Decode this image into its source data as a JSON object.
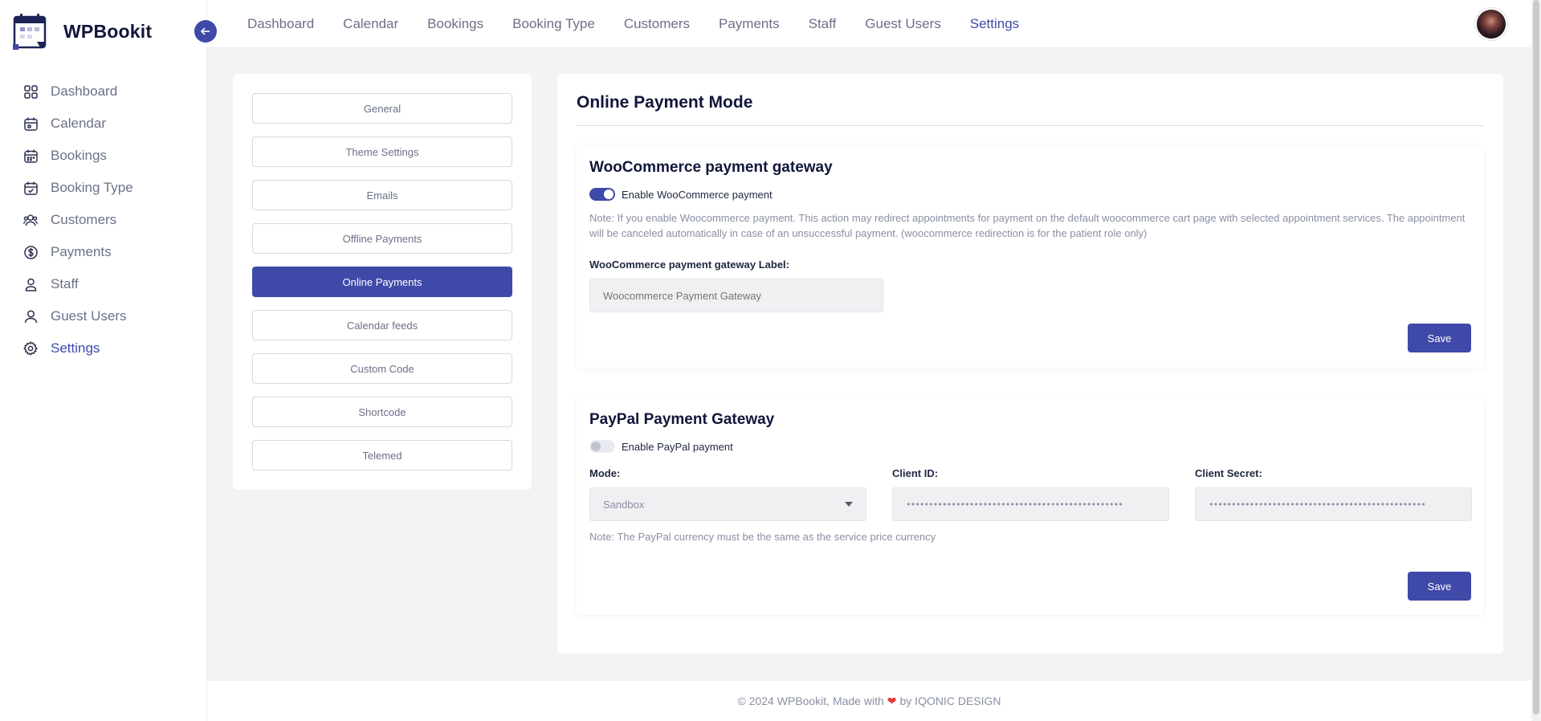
{
  "brand": {
    "name": "WPBookit"
  },
  "sidebar": {
    "items": [
      {
        "label": "Dashboard",
        "icon": "grid-icon"
      },
      {
        "label": "Calendar",
        "icon": "calendar-icon"
      },
      {
        "label": "Bookings",
        "icon": "calendar-grid-icon"
      },
      {
        "label": "Booking Type",
        "icon": "calendar-check-icon"
      },
      {
        "label": "Customers",
        "icon": "users-icon"
      },
      {
        "label": "Payments",
        "icon": "dollar-circle-icon"
      },
      {
        "label": "Staff",
        "icon": "user-icon"
      },
      {
        "label": "Guest Users",
        "icon": "user-outline-icon"
      },
      {
        "label": "Settings",
        "icon": "gear-icon"
      }
    ],
    "active": "Settings"
  },
  "topnav": {
    "items": [
      "Dashboard",
      "Calendar",
      "Bookings",
      "Booking Type",
      "Customers",
      "Payments",
      "Staff",
      "Guest Users",
      "Settings"
    ],
    "active": "Settings"
  },
  "settings_tabs": {
    "items": [
      "General",
      "Theme Settings",
      "Emails",
      "Offline Payments",
      "Online Payments",
      "Calendar feeds",
      "Custom Code",
      "Shortcode",
      "Telemed"
    ],
    "active": "Online Payments"
  },
  "main": {
    "title": "Online Payment Mode",
    "woocommerce": {
      "title": "WooCommerce payment gateway",
      "toggle_label": "Enable WooCommerce payment",
      "enabled": true,
      "note": "Note: If you enable Woocommerce payment. This action may redirect appointments for payment on the default woocommerce cart page with selected appointment services. The appointment will be canceled automatically in case of an unsuccessful payment. (woocommerce redirection is for the patient role only)",
      "label_field_label": "WooCommerce payment gateway Label:",
      "label_field_placeholder": "Woocommerce Payment Gateway",
      "save_label": "Save"
    },
    "paypal": {
      "title": "PayPal Payment Gateway",
      "toggle_label": "Enable PayPal payment",
      "enabled": false,
      "mode_label": "Mode:",
      "mode_value": "Sandbox",
      "client_id_label": "Client ID:",
      "client_id_value": "••••••••••••••••••••••••••••••••••••••••••••••••",
      "client_secret_label": "Client Secret:",
      "client_secret_value": "••••••••••••••••••••••••••••••••••••••••••••••••",
      "note": "Note: The PayPal currency must be the same as the service price currency",
      "save_label": "Save"
    }
  },
  "footer": {
    "prefix": "© 2024 WPBookit, Made with",
    "heart": "❤",
    "suffix": "by IQONIC DESIGN"
  },
  "colors": {
    "accent": "#3f4aa8",
    "text": "#1f2640",
    "muted": "#6b7088",
    "heart": "#e53935"
  }
}
